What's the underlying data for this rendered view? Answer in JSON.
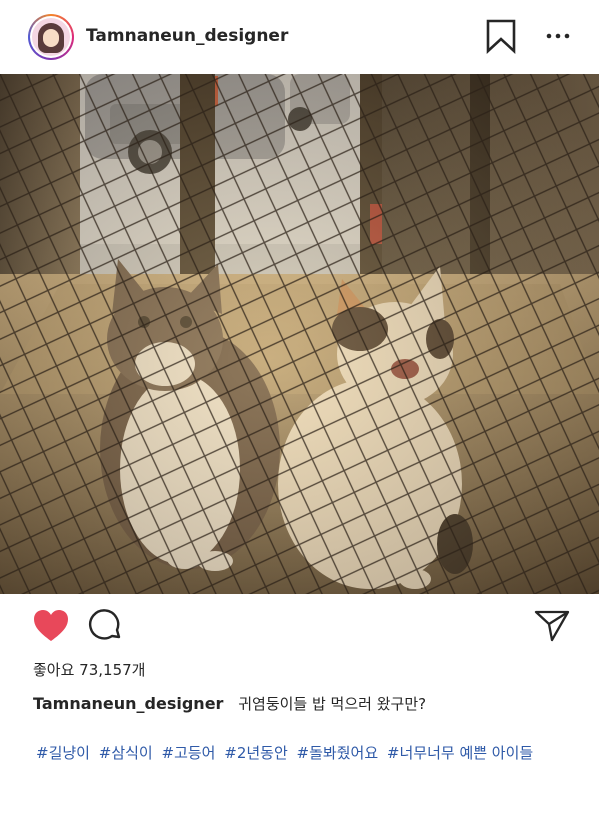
{
  "post": {
    "username": "Tamnaneun_designer",
    "likes_text": "좋아요 73,157개",
    "caption_user": "Tamnaneun_designer",
    "caption_text": "귀염둥이들 밥 먹으러 왔구만?",
    "hashtags": [
      "#길냥이",
      "#삼식이",
      "#고등어",
      "#2년동안",
      "#돌봐줬어요",
      "#너무너무 예쁜 아이들"
    ]
  },
  "icons": {
    "avatar": "profile-avatar",
    "bookmark": "bookmark-icon",
    "more": "more-options-icon",
    "like": "heart-icon",
    "comment": "comment-icon",
    "share": "send-icon"
  },
  "colors": {
    "heart": "#e8485a",
    "hashtag": "#2f5aa8",
    "text": "#262626"
  }
}
